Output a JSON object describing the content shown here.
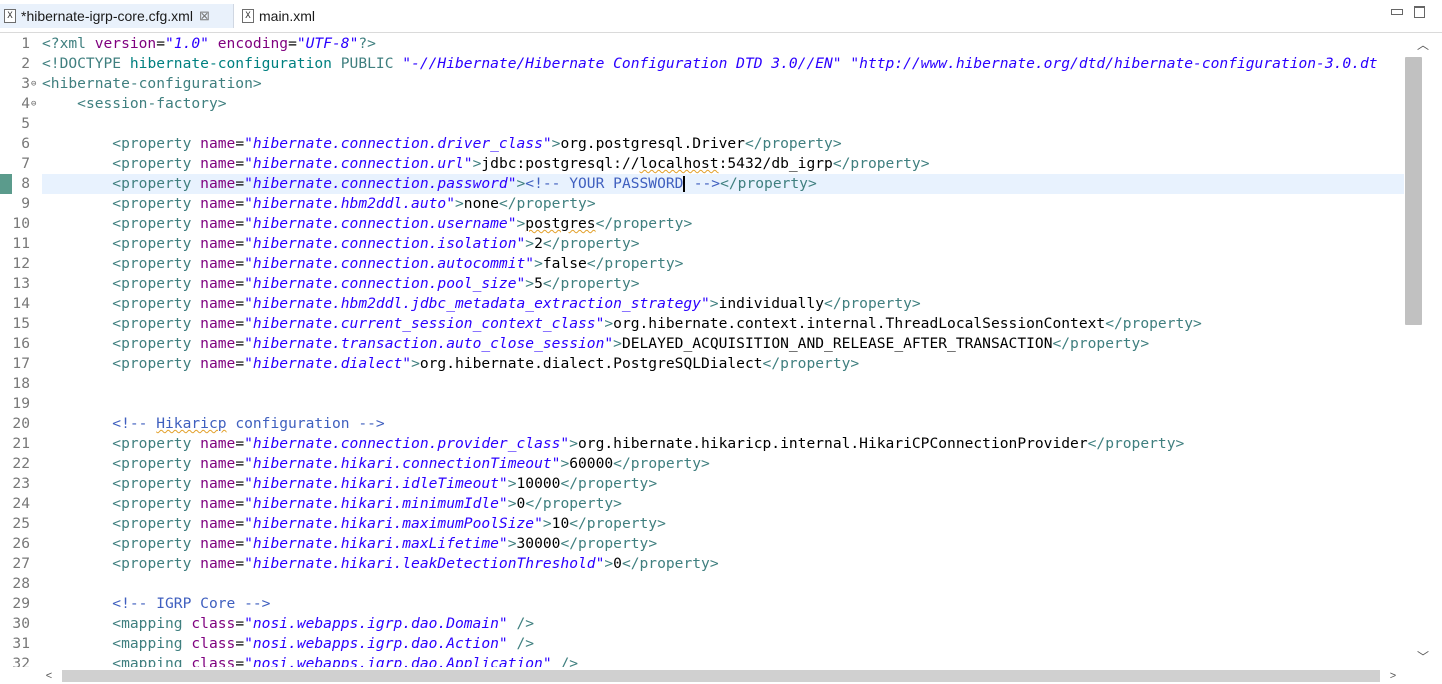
{
  "tabs": [
    {
      "label": "*hibernate-igrp-core.cfg.xml",
      "icon": "xml-file-icon",
      "close": "⊠",
      "active": true
    },
    {
      "label": "main.xml",
      "icon": "xml-file-icon",
      "active": false
    }
  ],
  "colors": {
    "tag": "#3f7f7f",
    "attribute": "#7f007f",
    "value": "#2a00ff",
    "text": "#000000",
    "comment": "#3f5fbf",
    "doctype": "#008080",
    "current_line": "#e8f2fe",
    "change_marker": "#5b9b8c"
  },
  "editor": {
    "current_line": 8,
    "lines": [
      {
        "n": "1",
        "segs": [
          [
            "t",
            "<?xml "
          ],
          [
            "a",
            "version"
          ],
          [
            "x",
            "="
          ],
          [
            "v",
            "\"1.0\""
          ],
          [
            "x",
            " "
          ],
          [
            "a",
            "encoding"
          ],
          [
            "x",
            "="
          ],
          [
            "v",
            "\"UTF-8\""
          ],
          [
            "t",
            "?>"
          ]
        ]
      },
      {
        "n": "2",
        "segs": [
          [
            "t",
            "<!DOCTYPE "
          ],
          [
            "d",
            "hibernate-configuration"
          ],
          [
            "x",
            " "
          ],
          [
            "t",
            "PUBLIC"
          ],
          [
            "x",
            " "
          ],
          [
            "v",
            "\"-//Hibernate/Hibernate Configuration DTD 3.0//EN\""
          ],
          [
            "x",
            " "
          ],
          [
            "v",
            "\"http://www.hibernate.org/dtd/hibernate-configuration-3.0.dt"
          ]
        ]
      },
      {
        "n": "3",
        "fold": true,
        "segs": [
          [
            "t",
            "<hibernate-configuration>"
          ]
        ]
      },
      {
        "n": "4",
        "fold": true,
        "segs": [
          [
            "x",
            "    "
          ],
          [
            "t",
            "<session-factory>"
          ]
        ]
      },
      {
        "n": "5",
        "segs": []
      },
      {
        "n": "6",
        "segs": [
          [
            "x",
            "        "
          ],
          [
            "t",
            "<property "
          ],
          [
            "a",
            "name"
          ],
          [
            "x",
            "="
          ],
          [
            "v",
            "\"hibernate.connection.driver_class\""
          ],
          [
            "t",
            ">"
          ],
          [
            "x",
            "org.postgresql.Driver"
          ],
          [
            "t",
            "</property>"
          ]
        ]
      },
      {
        "n": "7",
        "segs": [
          [
            "x",
            "        "
          ],
          [
            "t",
            "<property "
          ],
          [
            "a",
            "name"
          ],
          [
            "x",
            "="
          ],
          [
            "v",
            "\"hibernate.connection.url\""
          ],
          [
            "t",
            ">"
          ],
          [
            "x",
            "jdbc:postgresql://"
          ],
          [
            "xs",
            "localhost"
          ],
          [
            "x",
            ":5432/db_igrp"
          ],
          [
            "t",
            "</property>"
          ]
        ]
      },
      {
        "n": "8",
        "segs": [
          [
            "x",
            "        "
          ],
          [
            "t",
            "<property "
          ],
          [
            "a",
            "name"
          ],
          [
            "x",
            "="
          ],
          [
            "v",
            "\"hibernate.connection.password\""
          ],
          [
            "t",
            ">"
          ],
          [
            "c",
            "<!-- YOUR PASSWORD"
          ],
          [
            "caret",
            ""
          ],
          [
            "c",
            " -->"
          ],
          [
            "t",
            "</property>"
          ]
        ]
      },
      {
        "n": "9",
        "segs": [
          [
            "x",
            "        "
          ],
          [
            "t",
            "<property "
          ],
          [
            "a",
            "name"
          ],
          [
            "x",
            "="
          ],
          [
            "v",
            "\"hibernate.hbm2ddl.auto\""
          ],
          [
            "t",
            ">"
          ],
          [
            "x",
            "none"
          ],
          [
            "t",
            "</property>"
          ]
        ]
      },
      {
        "n": "10",
        "segs": [
          [
            "x",
            "        "
          ],
          [
            "t",
            "<property "
          ],
          [
            "a",
            "name"
          ],
          [
            "x",
            "="
          ],
          [
            "v",
            "\"hibernate.connection.username\""
          ],
          [
            "t",
            ">"
          ],
          [
            "xs",
            "postgres"
          ],
          [
            "t",
            "</property>"
          ]
        ]
      },
      {
        "n": "11",
        "segs": [
          [
            "x",
            "        "
          ],
          [
            "t",
            "<property "
          ],
          [
            "a",
            "name"
          ],
          [
            "x",
            "="
          ],
          [
            "v",
            "\"hibernate.connection.isolation\""
          ],
          [
            "t",
            ">"
          ],
          [
            "x",
            "2"
          ],
          [
            "t",
            "</property>"
          ]
        ]
      },
      {
        "n": "12",
        "segs": [
          [
            "x",
            "        "
          ],
          [
            "t",
            "<property "
          ],
          [
            "a",
            "name"
          ],
          [
            "x",
            "="
          ],
          [
            "v",
            "\"hibernate.connection.autocommit\""
          ],
          [
            "t",
            ">"
          ],
          [
            "x",
            "false"
          ],
          [
            "t",
            "</property>"
          ]
        ]
      },
      {
        "n": "13",
        "segs": [
          [
            "x",
            "        "
          ],
          [
            "t",
            "<property "
          ],
          [
            "a",
            "name"
          ],
          [
            "x",
            "="
          ],
          [
            "v",
            "\"hibernate.connection.pool_size\""
          ],
          [
            "t",
            ">"
          ],
          [
            "x",
            "5"
          ],
          [
            "t",
            "</property>"
          ]
        ]
      },
      {
        "n": "14",
        "segs": [
          [
            "x",
            "        "
          ],
          [
            "t",
            "<property "
          ],
          [
            "a",
            "name"
          ],
          [
            "x",
            "="
          ],
          [
            "v",
            "\"hibernate.hbm2ddl.jdbc_metadata_extraction_strategy\""
          ],
          [
            "t",
            ">"
          ],
          [
            "x",
            "individually"
          ],
          [
            "t",
            "</property>"
          ]
        ]
      },
      {
        "n": "15",
        "segs": [
          [
            "x",
            "        "
          ],
          [
            "t",
            "<property "
          ],
          [
            "a",
            "name"
          ],
          [
            "x",
            "="
          ],
          [
            "v",
            "\"hibernate.current_session_context_class\""
          ],
          [
            "t",
            ">"
          ],
          [
            "x",
            "org.hibernate.context.internal.ThreadLocalSessionContext"
          ],
          [
            "t",
            "</property>"
          ]
        ]
      },
      {
        "n": "16",
        "segs": [
          [
            "x",
            "        "
          ],
          [
            "t",
            "<property "
          ],
          [
            "a",
            "name"
          ],
          [
            "x",
            "="
          ],
          [
            "v",
            "\"hibernate.transaction.auto_close_session\""
          ],
          [
            "t",
            ">"
          ],
          [
            "x",
            "DELAYED_ACQUISITION_AND_RELEASE_AFTER_TRANSACTION"
          ],
          [
            "t",
            "</property>"
          ]
        ]
      },
      {
        "n": "17",
        "segs": [
          [
            "x",
            "        "
          ],
          [
            "t",
            "<property "
          ],
          [
            "a",
            "name"
          ],
          [
            "x",
            "="
          ],
          [
            "v",
            "\"hibernate.dialect\""
          ],
          [
            "t",
            ">"
          ],
          [
            "x",
            "org.hibernate.dialect.PostgreSQLDialect"
          ],
          [
            "t",
            "</property>"
          ]
        ]
      },
      {
        "n": "18",
        "segs": []
      },
      {
        "n": "19",
        "segs": []
      },
      {
        "n": "20",
        "segs": [
          [
            "x",
            "        "
          ],
          [
            "c",
            "<!-- "
          ],
          [
            "cs",
            "Hikaricp"
          ],
          [
            "c",
            " configuration -->"
          ]
        ]
      },
      {
        "n": "21",
        "segs": [
          [
            "x",
            "        "
          ],
          [
            "t",
            "<property "
          ],
          [
            "a",
            "name"
          ],
          [
            "x",
            "="
          ],
          [
            "v",
            "\"hibernate.connection.provider_class\""
          ],
          [
            "t",
            ">"
          ],
          [
            "x",
            "org.hibernate.hikaricp.internal.HikariCPConnectionProvider"
          ],
          [
            "t",
            "</property>"
          ]
        ]
      },
      {
        "n": "22",
        "segs": [
          [
            "x",
            "        "
          ],
          [
            "t",
            "<property "
          ],
          [
            "a",
            "name"
          ],
          [
            "x",
            "="
          ],
          [
            "v",
            "\"hibernate.hikari.connectionTimeout\""
          ],
          [
            "t",
            ">"
          ],
          [
            "x",
            "60000"
          ],
          [
            "t",
            "</property>"
          ]
        ]
      },
      {
        "n": "23",
        "segs": [
          [
            "x",
            "        "
          ],
          [
            "t",
            "<property "
          ],
          [
            "a",
            "name"
          ],
          [
            "x",
            "="
          ],
          [
            "v",
            "\"hibernate.hikari.idleTimeout\""
          ],
          [
            "t",
            ">"
          ],
          [
            "x",
            "10000"
          ],
          [
            "t",
            "</property>"
          ]
        ]
      },
      {
        "n": "24",
        "segs": [
          [
            "x",
            "        "
          ],
          [
            "t",
            "<property "
          ],
          [
            "a",
            "name"
          ],
          [
            "x",
            "="
          ],
          [
            "v",
            "\"hibernate.hikari.minimumIdle\""
          ],
          [
            "t",
            ">"
          ],
          [
            "x",
            "0"
          ],
          [
            "t",
            "</property>"
          ]
        ]
      },
      {
        "n": "25",
        "segs": [
          [
            "x",
            "        "
          ],
          [
            "t",
            "<property "
          ],
          [
            "a",
            "name"
          ],
          [
            "x",
            "="
          ],
          [
            "v",
            "\"hibernate.hikari.maximumPoolSize\""
          ],
          [
            "t",
            ">"
          ],
          [
            "x",
            "10"
          ],
          [
            "t",
            "</property>"
          ]
        ]
      },
      {
        "n": "26",
        "segs": [
          [
            "x",
            "        "
          ],
          [
            "t",
            "<property "
          ],
          [
            "a",
            "name"
          ],
          [
            "x",
            "="
          ],
          [
            "v",
            "\"hibernate.hikari.maxLifetime\""
          ],
          [
            "t",
            ">"
          ],
          [
            "x",
            "30000"
          ],
          [
            "t",
            "</property>"
          ]
        ]
      },
      {
        "n": "27",
        "segs": [
          [
            "x",
            "        "
          ],
          [
            "t",
            "<property "
          ],
          [
            "a",
            "name"
          ],
          [
            "x",
            "="
          ],
          [
            "v",
            "\"hibernate.hikari.leakDetectionThreshold\""
          ],
          [
            "t",
            ">"
          ],
          [
            "x",
            "0"
          ],
          [
            "t",
            "</property>"
          ]
        ]
      },
      {
        "n": "28",
        "segs": []
      },
      {
        "n": "29",
        "segs": [
          [
            "x",
            "        "
          ],
          [
            "c",
            "<!-- IGRP Core -->"
          ]
        ]
      },
      {
        "n": "30",
        "segs": [
          [
            "x",
            "        "
          ],
          [
            "t",
            "<mapping "
          ],
          [
            "a",
            "class"
          ],
          [
            "x",
            "="
          ],
          [
            "v",
            "\"nosi.webapps.igrp.dao.Domain\""
          ],
          [
            "x",
            " "
          ],
          [
            "t",
            "/>"
          ]
        ]
      },
      {
        "n": "31",
        "segs": [
          [
            "x",
            "        "
          ],
          [
            "t",
            "<mapping "
          ],
          [
            "a",
            "class"
          ],
          [
            "x",
            "="
          ],
          [
            "v",
            "\"nosi.webapps.igrp.dao.Action\""
          ],
          [
            "x",
            " "
          ],
          [
            "t",
            "/>"
          ]
        ]
      },
      {
        "n": "32",
        "segs": [
          [
            "x",
            "        "
          ],
          [
            "t",
            "<mapping "
          ],
          [
            "a",
            "class"
          ],
          [
            "x",
            "="
          ],
          [
            "v",
            "\"nosi.webapps.igrp.dao.Application\""
          ],
          [
            "x",
            " "
          ],
          [
            "t",
            "/>"
          ]
        ]
      }
    ]
  },
  "scrollbars": {
    "vertical": {
      "up": "︿",
      "down": "﹀",
      "position": 0.0
    },
    "horizontal": {
      "left": "<",
      "right": ">",
      "position": 0.0
    }
  }
}
